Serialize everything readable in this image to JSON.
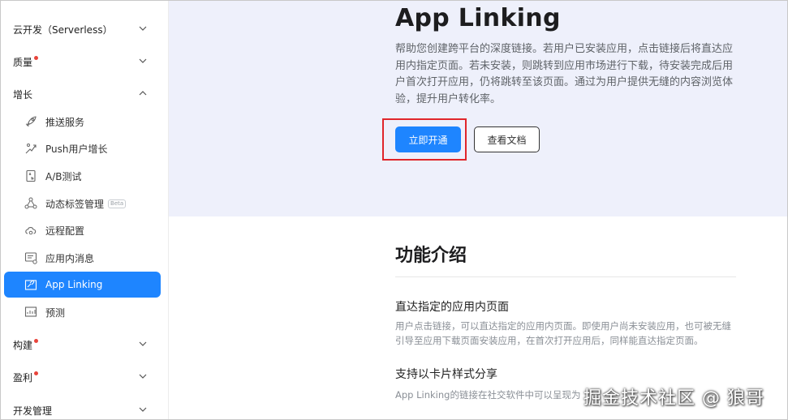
{
  "sidebar": {
    "groups": [
      {
        "label": "云开发（Serverless）",
        "has_dot": false
      },
      {
        "label": "质量",
        "has_dot": true
      },
      {
        "label": "增长",
        "has_dot": false
      },
      {
        "label": "构建",
        "has_dot": true
      },
      {
        "label": "盈利",
        "has_dot": true
      },
      {
        "label": "开发管理",
        "has_dot": false
      }
    ],
    "items": [
      {
        "label": "推送服务",
        "icon": "rocket-icon"
      },
      {
        "label": "Push用户增长",
        "icon": "growth-icon"
      },
      {
        "label": "A/B测试",
        "icon": "ab-test-icon"
      },
      {
        "label": "动态标签管理",
        "icon": "tag-network-icon",
        "badge": "Beta"
      },
      {
        "label": "远程配置",
        "icon": "cloud-config-icon"
      },
      {
        "label": "应用内消息",
        "icon": "message-icon"
      },
      {
        "label": "App Linking",
        "icon": "link-icon",
        "active": true
      },
      {
        "label": "预测",
        "icon": "chart-icon"
      }
    ]
  },
  "hero": {
    "title": "App Linking",
    "description": "帮助您创建跨平台的深度链接。若用户已安装应用，点击链接后将直达应用内指定页面。若未安装，则跳转到应用市场进行下载，待安装完成后用户首次打开应用，仍将跳转至该页面。通过为用户提供无缝的内容浏览体验，提升用户转化率。",
    "primary_button": "立即开通",
    "secondary_button": "查看文档"
  },
  "features": {
    "section_title": "功能介绍",
    "items": [
      {
        "title": "直达指定的应用内页面",
        "description": "用户点击链接，可以直达指定的应用内页面。即使用户尚未安装应用，也可被无缝引导至应用下载页面安装应用，在首次打开应用后，同样能直达指定页面。"
      },
      {
        "title": "支持以卡片样式分享",
        "description": "App Linking的链接在社交软件中可以呈现为"
      }
    ]
  },
  "watermark": "掘金技术社区 @ 狼哥",
  "colors": {
    "accent": "#1e85ff",
    "hero_bg": "#eef0fb",
    "highlight": "#e0262b",
    "dot": "#e8443b"
  }
}
